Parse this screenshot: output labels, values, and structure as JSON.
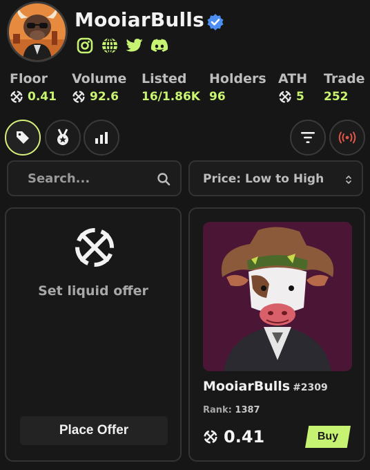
{
  "collection": {
    "name": "MooiarBulls",
    "verified": true
  },
  "socials": [
    "instagram-icon",
    "globe-icon",
    "twitter-icon",
    "discord-icon"
  ],
  "stats": [
    {
      "label": "Floor",
      "value": "0.41",
      "has_egld": true
    },
    {
      "label": "Volume",
      "value": "92.6",
      "has_egld": true
    },
    {
      "label": "Listed",
      "value": "16/1.86K",
      "has_egld": false
    },
    {
      "label": "Holders",
      "value": "96",
      "has_egld": false
    },
    {
      "label": "ATH",
      "value": "5",
      "has_egld": true
    },
    {
      "label": "Trade",
      "value": "252",
      "has_egld": false
    }
  ],
  "toolbar": {
    "active_tab": "tag-icon"
  },
  "search": {
    "placeholder": "Search..."
  },
  "sort": {
    "selected": "Price: Low to High"
  },
  "offer_card": {
    "text": "Set liquid offer",
    "button": "Place Offer"
  },
  "nft_card": {
    "name": "MooiarBulls",
    "number": "#2309",
    "rank_label": "Rank:",
    "rank_value": "1387",
    "price": "0.41",
    "buy_label": "Buy"
  },
  "colors": {
    "accent": "#c7f372",
    "background": "#161616",
    "verified": "#4d8ff0",
    "live": "#e2554a"
  }
}
